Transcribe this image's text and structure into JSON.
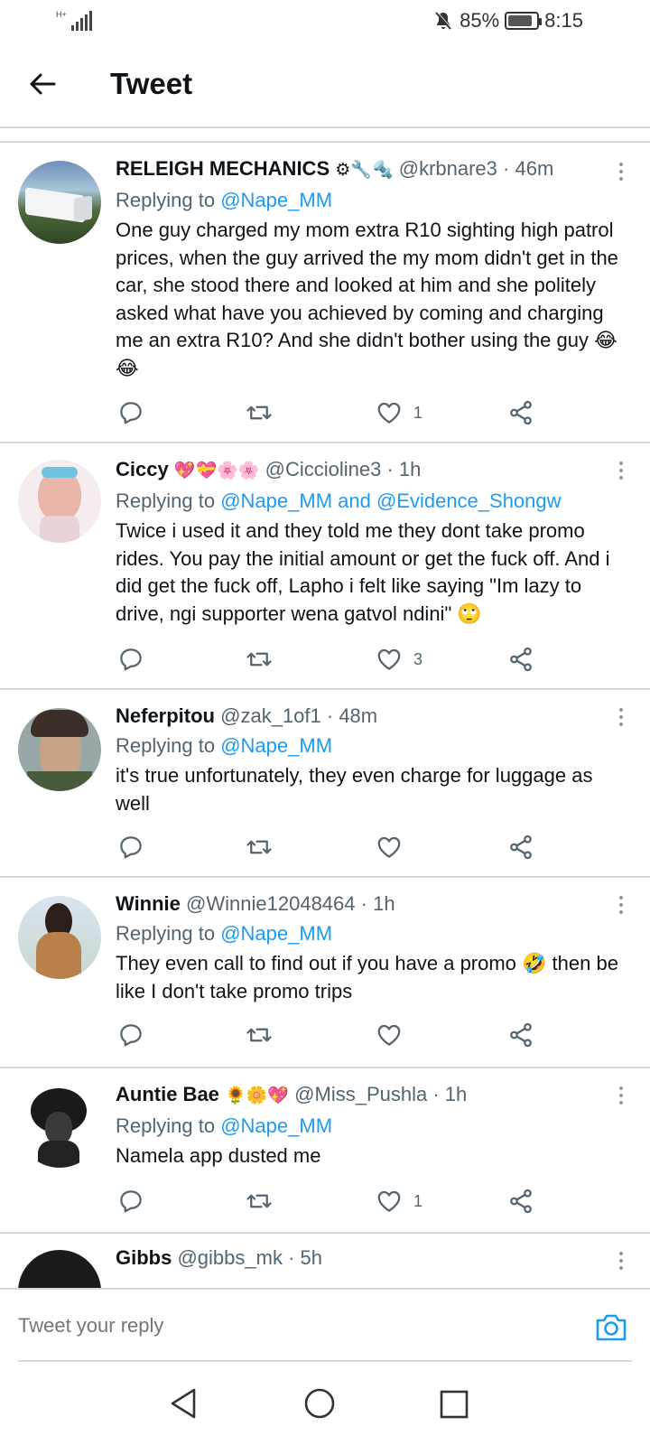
{
  "status_bar": {
    "network": "H+",
    "battery_text": "85%",
    "battery_level": 0.85,
    "time": "8:15"
  },
  "header": {
    "title": "Tweet"
  },
  "tweets": [
    {
      "name": "RELEIGH MECHANICS",
      "name_emoji": "⚙🔧🔩",
      "handle": "@krbnare3",
      "time": "· 46m",
      "replying_prefix": "Replying to",
      "replying_to": "@Nape_MM",
      "text": "One guy charged my mom extra R10 sighting high patrol prices, when the guy arrived the my mom didn't get in the car, she stood there and looked at him and she politely asked what have you achieved by coming and charging me an extra R10? And she didn't bother using the guy 😂😂",
      "likes": "1"
    },
    {
      "name": "Ciccy",
      "name_emoji": "💖💝🌸🌸",
      "handle": "@Ciccioline3",
      "time": "· 1h",
      "replying_prefix": "Replying to",
      "replying_to": "@Nape_MM and @Evidence_Shongw",
      "text": "Twice i used it and they told me they dont take promo rides. You pay the initial amount or get the fuck off. And i did get the fuck off, Lapho i felt like saying \"Im lazy to drive, ngi supporter wena gatvol ndini\" 🙄",
      "likes": "3"
    },
    {
      "name": "Neferpitou",
      "name_emoji": "",
      "handle": "@zak_1of1",
      "time": "· 48m",
      "replying_prefix": "Replying to",
      "replying_to": "@Nape_MM",
      "text": "it's true unfortunately, they even charge for luggage as well",
      "likes": ""
    },
    {
      "name": "Winnie",
      "name_emoji": "",
      "handle": "@Winnie12048464",
      "time": "· 1h",
      "replying_prefix": "Replying to",
      "replying_to": "@Nape_MM",
      "text": "They even call to find out if you have a promo 🤣 then be like I don't take promo trips",
      "likes": ""
    },
    {
      "name": "Auntie Bae",
      "name_emoji": "🌻🌼💖",
      "handle": "@Miss_Pushla",
      "time": "· 1h",
      "replying_prefix": "Replying to",
      "replying_to": "@Nape_MM",
      "text": "Namela app dusted me",
      "likes": "1"
    },
    {
      "name": "Gibbs",
      "name_emoji": "",
      "handle": "@gibbs_mk",
      "time": "· 5h",
      "replying_prefix": "",
      "replying_to": "",
      "text": "",
      "likes": ""
    }
  ],
  "reply_bar": {
    "placeholder": "Tweet your reply"
  },
  "colors": {
    "accent": "#1d9bf0",
    "text": "#0f1419",
    "secondary": "#536471",
    "divider": "#cfd9de"
  }
}
